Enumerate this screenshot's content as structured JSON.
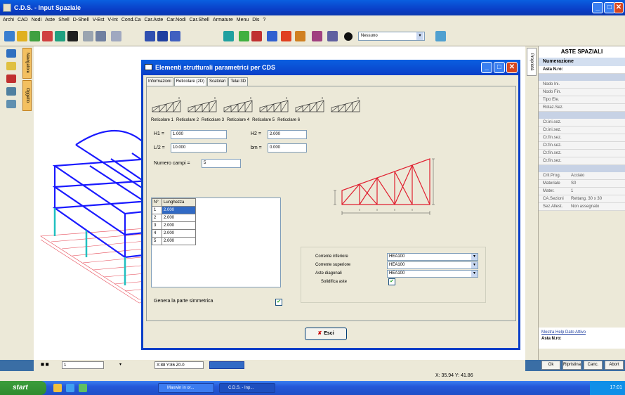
{
  "window": {
    "title": "C.D.S. - Input Spaziale"
  },
  "menu": [
    "Archi",
    "CAD",
    "Nodi",
    "Aste",
    "Shell",
    "D-Shell",
    "V-Est",
    "V-Int",
    "Cond.Ca",
    "Car.Aste",
    "Car.Nodi",
    "Car.Shell",
    "Armature",
    "Menu",
    "Dis",
    "?"
  ],
  "toolbar": {
    "combo_value": "Nessuno"
  },
  "left_tabs": [
    "Navigatore",
    "Oggetto"
  ],
  "props_tab": "Proprietà",
  "right_panel": {
    "title": "ASTE SPAZIALI",
    "section1_head": "Numerazione",
    "section1_row": "Asta N.ro:",
    "rows_a": [
      "Nodo Ini.",
      "Nodo Fin.",
      "Tipo Ele.",
      "Rotaz.Sez."
    ],
    "rows_b": [
      "Cr.ini.sez.",
      "Cr.ini.sez.",
      "Cr.fin.sez.",
      "Cr.fin.sez.",
      "Cr.fin.sez.",
      "Cr.fin.sez."
    ],
    "rows_c": [
      {
        "k": "Crit.Prog.",
        "v": "Acciaio"
      },
      {
        "k": "Materiale",
        "v": "S0"
      },
      {
        "k": "Mater.",
        "v": "1"
      },
      {
        "k": "CA.Sezioni",
        "v": "Rettang. 30 x 30"
      },
      {
        "k": "Sez.Allest.",
        "v": "Non assegnato"
      }
    ],
    "bottom_link": "Mostra Help Dato Attivo",
    "bottom_label": "Asta N.ro:",
    "buttons": [
      "Ok",
      "Ripristina",
      "Canc.",
      "Abort"
    ]
  },
  "bottom": {
    "zoom_value": "1",
    "coords_field": "X:88  Y:86  Z0.0",
    "status_coords": "X: 35.94  Y: 41.86"
  },
  "taskbar": {
    "start_label": "start",
    "task1": "Maxwin in or...",
    "task2": "C.D.S. - Inp...",
    "clock": "17:01"
  },
  "dialog": {
    "title": "Elementi strutturali parametrici per CDS",
    "tabs": [
      "Informazioni",
      "Reticolare (2D)",
      "Scatolari",
      "Telai 3D"
    ],
    "active_tab": 1,
    "thumb_labels": [
      "Reticolare 1",
      "Reticolare 2",
      "Reticolare 3",
      "Reticolare 4",
      "Reticolare 5",
      "Reticolare 6"
    ],
    "fields": {
      "h1_label": "H1 =",
      "h1_value": "1.000",
      "h2_label": "H2 =",
      "h2_value": "2.000",
      "l2_label": "L/2 =",
      "l2_value": "10.000",
      "bm_label": "bm =",
      "bm_value": "0.000",
      "campi_label": "Numero campi =",
      "campi_value": "5"
    },
    "table": {
      "headers": [
        "N°",
        "Lunghezza"
      ],
      "rows": [
        [
          "1",
          "2.000"
        ],
        [
          "2",
          "2.000"
        ],
        [
          "3",
          "2.000"
        ],
        [
          "4",
          "2.000"
        ],
        [
          "5",
          "2.000"
        ]
      ]
    },
    "genera_label": "Genera la parte simmetrica",
    "genera_checked": "✔",
    "sections": [
      {
        "label": "Corrente inferiore",
        "value": "HEA100"
      },
      {
        "label": "Corrente superiore",
        "value": "HEA100"
      },
      {
        "label": "Aste diagonali",
        "value": "HEA100"
      },
      {
        "label": "Solidifica aste",
        "value": "✔"
      }
    ],
    "esci_label": "Esci"
  },
  "colors": {
    "xp_blue": "#0a3fc8",
    "structure_blue": "#1a1aff",
    "truss_red": "#e02030",
    "columns_cyan": "#20c0c0"
  }
}
